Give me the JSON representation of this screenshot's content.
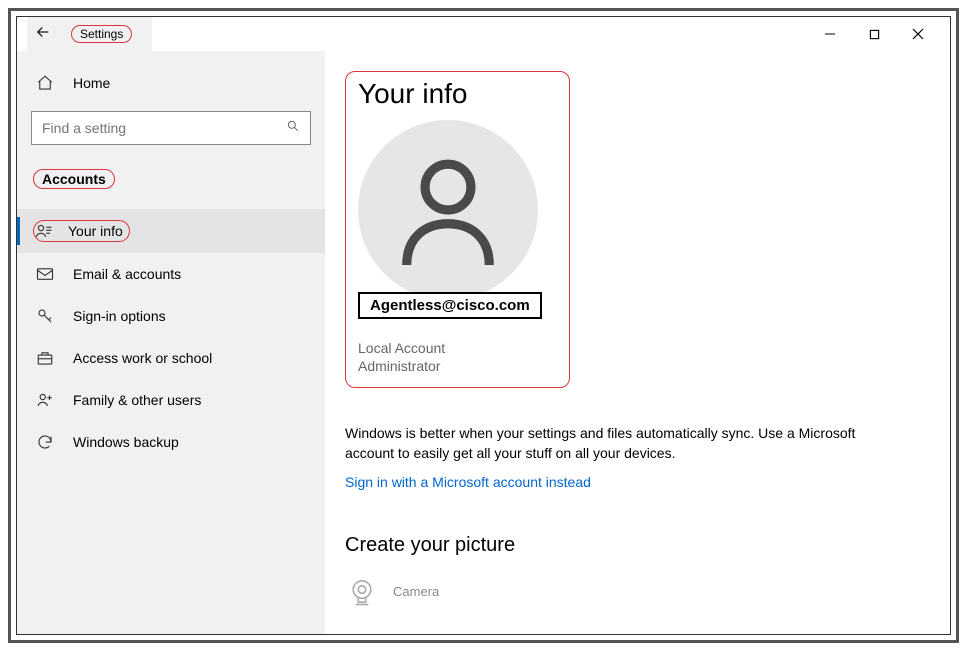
{
  "header": {
    "title": "Settings"
  },
  "sidebar": {
    "home_label": "Home",
    "search_placeholder": "Find a setting",
    "category": "Accounts",
    "items": [
      {
        "label": "Your info"
      },
      {
        "label": "Email & accounts"
      },
      {
        "label": "Sign-in options"
      },
      {
        "label": "Access work or school"
      },
      {
        "label": "Family & other users"
      },
      {
        "label": "Windows backup"
      }
    ]
  },
  "main": {
    "page_title": "Your info",
    "email": "Agentless@cisco.com",
    "account_line1": "Local Account",
    "account_line2": "Administrator",
    "desc": "Windows is better when your settings and files automatically sync. Use a Microsoft account to easily get all your stuff on all your devices.",
    "link": "Sign in with a Microsoft account instead",
    "picture_title": "Create your picture",
    "camera_label": "Camera"
  }
}
